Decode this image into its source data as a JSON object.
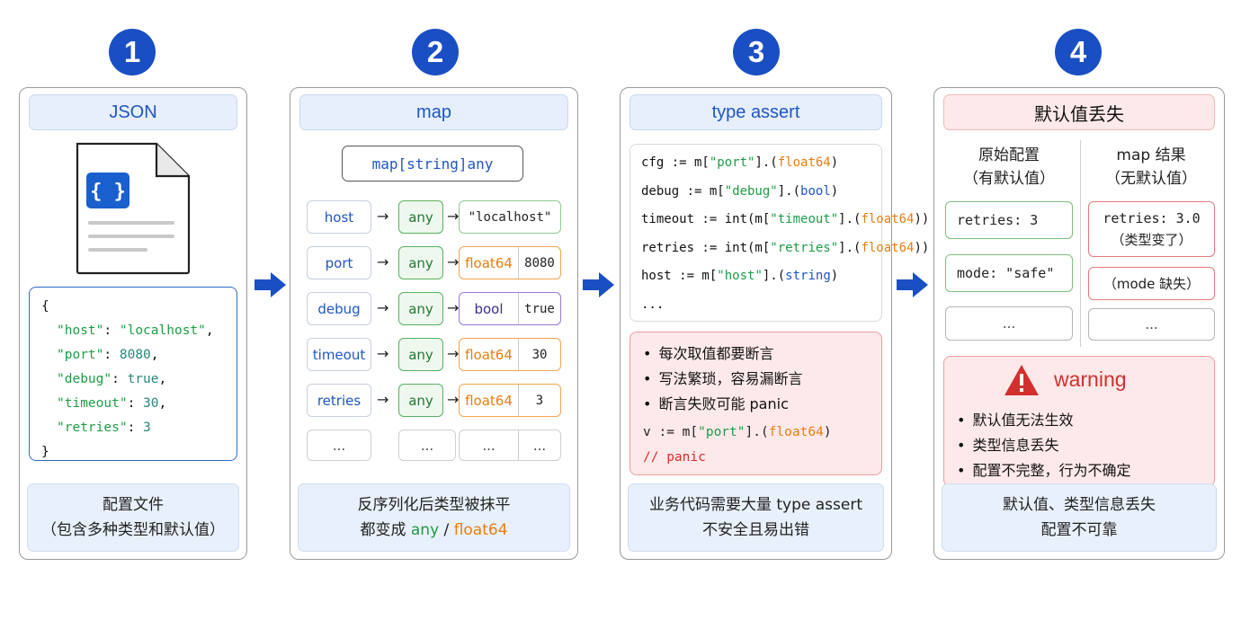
{
  "steps": [
    "1",
    "2",
    "3",
    "4"
  ],
  "p1": {
    "title": "JSON",
    "doc_icon": "json-file-icon",
    "json_lines": [
      {
        "k": "\"host\"",
        "v": "\"localhost\"",
        "t": "str",
        "c": ","
      },
      {
        "k": "\"port\"",
        "v": "8080",
        "t": "num",
        "c": ","
      },
      {
        "k": "\"debug\"",
        "v": "true",
        "t": "num",
        "c": ","
      },
      {
        "k": "\"timeout\"",
        "v": "30",
        "t": "num",
        "c": ","
      },
      {
        "k": "\"retries\"",
        "v": "3",
        "t": "num",
        "c": ""
      }
    ],
    "brace_open": "{",
    "brace_close": "}",
    "footer1": "配置文件",
    "footer2": "（包含多种类型和默认值）"
  },
  "p2": {
    "title": "map",
    "type": "map[string]any",
    "rows": [
      {
        "key": "host",
        "any": "any",
        "kind": "str",
        "val": "\"localhost\""
      },
      {
        "key": "port",
        "any": "any",
        "kind": "float",
        "type": "float64",
        "val": "8080"
      },
      {
        "key": "debug",
        "any": "any",
        "kind": "bool",
        "type": "bool",
        "val": "true"
      },
      {
        "key": "timeout",
        "any": "any",
        "kind": "float",
        "type": "float64",
        "val": "30"
      },
      {
        "key": "retries",
        "any": "any",
        "kind": "float",
        "type": "float64",
        "val": "3"
      }
    ],
    "dots": "...",
    "arrow": "→",
    "footer1": "反序列化后类型被抹平",
    "footer2_pre": "都变成 ",
    "footer2_any": "any",
    "footer2_sep": " / ",
    "footer2_float": "float64"
  },
  "p3": {
    "title": "type assert",
    "code": [
      {
        "a": "cfg := m[",
        "b": "\"port\"",
        "c": "].(",
        "d": "float64",
        "e": ")"
      },
      {
        "a": "debug := m[",
        "b": "\"debug\"",
        "c": "].(",
        "d": "bool",
        "e": ")"
      },
      {
        "a": "timeout := int(m[",
        "b": "\"timeout\"",
        "c": "].(",
        "d": "float64",
        "e": "))"
      },
      {
        "a": "retries := int(m[",
        "b": "\"retries\"",
        "c": "].(",
        "d": "float64",
        "e": "))"
      },
      {
        "a": "host := m[",
        "b": "\"host\"",
        "c": "].(",
        "d": "string",
        "e": ")"
      }
    ],
    "ellipsis": "...",
    "bullets": [
      "每次取值都要断言",
      "写法繁琐，容易漏断言",
      "断言失败可能 panic"
    ],
    "panic_code": {
      "a": "v := m[",
      "b": "\"port\"",
      "c": "].(",
      "d": "float64",
      "e": ")"
    },
    "panic_comment": "// panic",
    "footer1": "业务代码需要大量 type assert",
    "footer2": "不安全且易出错"
  },
  "p4": {
    "title": "默认值丢失",
    "left_head1": "原始配置",
    "left_head2": "（有默认值）",
    "right_head1": "map 结果",
    "right_head2": "（无默认值）",
    "left_items": [
      "retries: 3",
      "mode: \"safe\"",
      "..."
    ],
    "right_items": [
      "retries: 3.0",
      "（类型变了）",
      "（mode 缺失）",
      "..."
    ],
    "warning_title": "warning",
    "warning_bullets": [
      "默认值无法生效",
      "类型信息丢失",
      "配置不完整，行为不确定"
    ],
    "footer1": "默认值、类型信息丢失",
    "footer2": "配置不可靠"
  },
  "colors": {
    "accent": "#1a4fc4",
    "green": "#1d9c47",
    "orange": "#e67e10",
    "red": "#d32f2f"
  }
}
